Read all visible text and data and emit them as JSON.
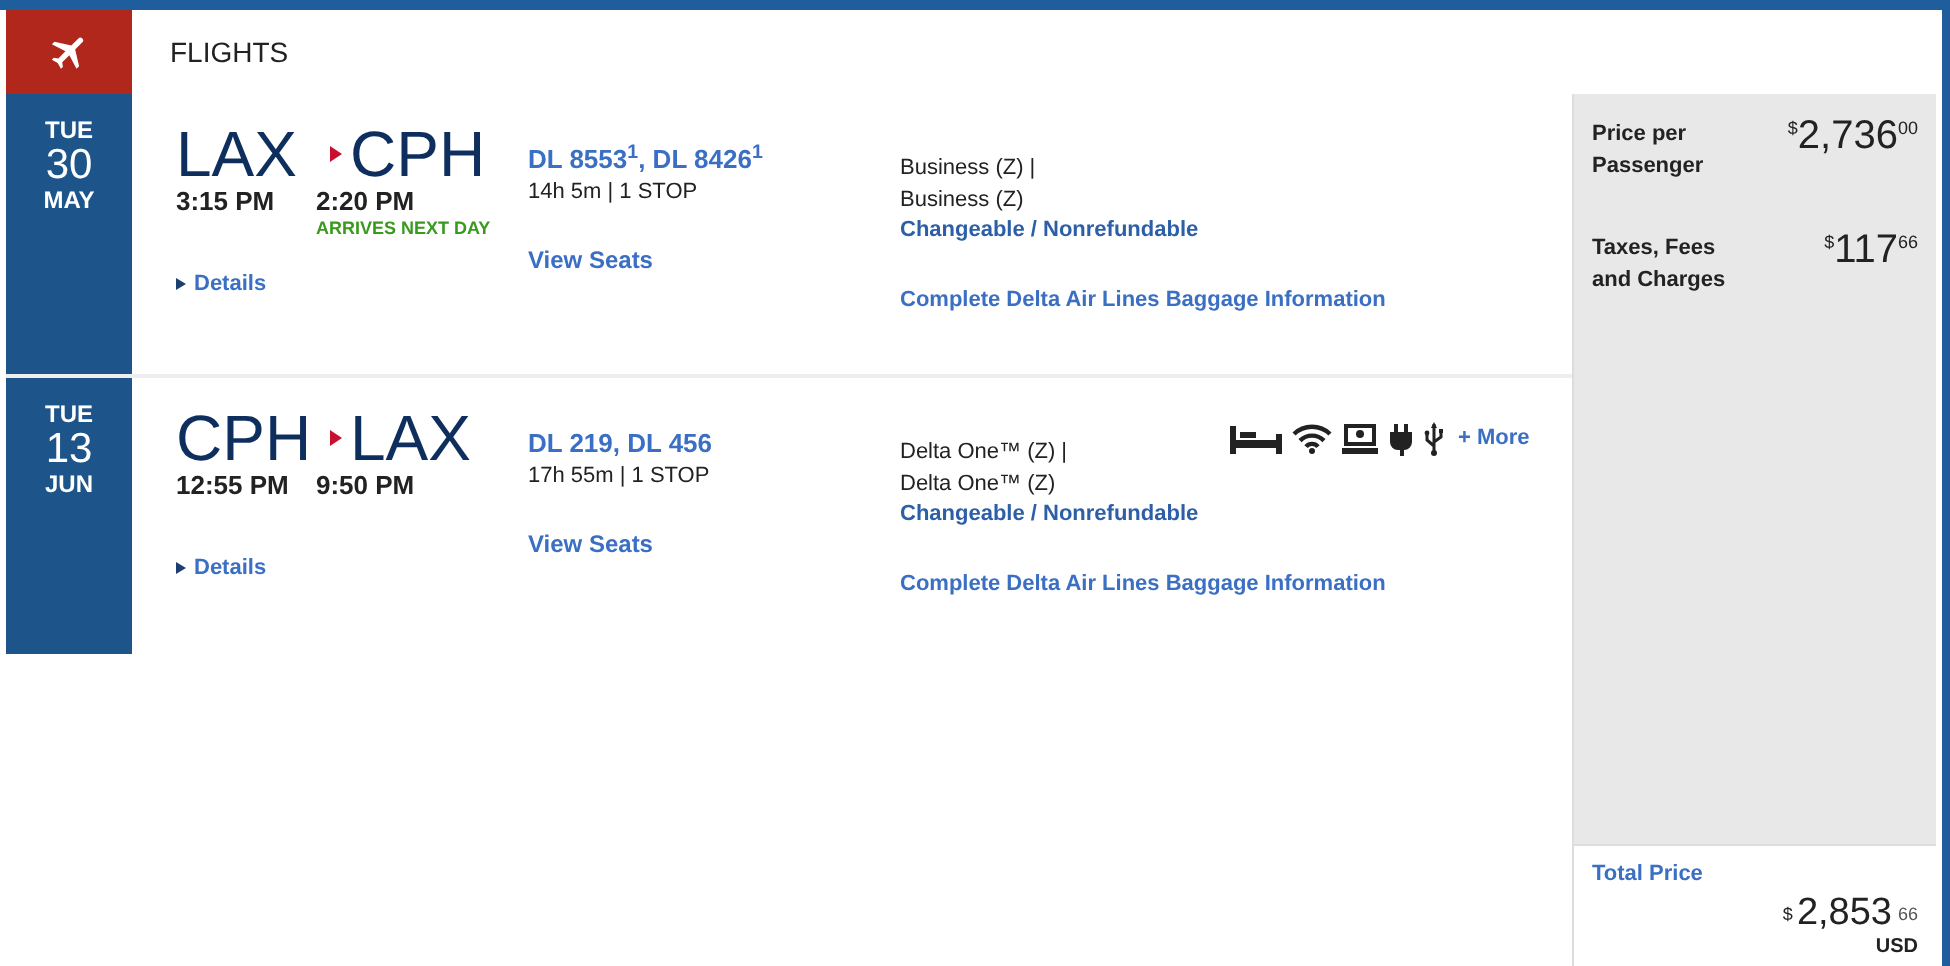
{
  "header": {
    "title": "FLIGHTS"
  },
  "legs": [
    {
      "date": {
        "weekday": "TUE",
        "day": "30",
        "month": "MAY"
      },
      "origin": "LAX",
      "destination": "CPH",
      "depart": "3:15 PM",
      "arrive": "2:20 PM",
      "arrival_note": "ARRIVES NEXT DAY",
      "flights": "DL 8553$^{1}$, DL 8426$^{1}$",
      "duration": "14h 5m | 1 STOP",
      "details": "Details",
      "view_seats": "View Seats",
      "cabin": [
        "Business (Z) |",
        "Business (Z)"
      ],
      "fare_rules": "Changeable / Nonrefundable",
      "baggage": "Complete Delta Air Lines Baggage Information"
    },
    {
      "date": {
        "weekday": "TUE",
        "day": "13",
        "month": "JUN"
      },
      "origin": "CPH",
      "destination": "LAX",
      "depart": "12:55 PM",
      "arrive": "9:50 PM",
      "flights": "DL 219, DL 456",
      "duration": "17h 55m | 1 STOP",
      "details": "Details",
      "view_seats": "View Seats",
      "cabin": [
        "Delta One™ (Z) |",
        "Delta One™ (Z)"
      ],
      "fare_rules": "Changeable / Nonrefundable",
      "baggage": "Complete Delta Air Lines Baggage Information",
      "amenities": [
        {
          "kind": "bed"
        },
        {
          "kind": "wifi"
        },
        {
          "kind": "screen"
        },
        {
          "kind": "power"
        },
        {
          "kind": "usb"
        }
      ],
      "more": "+ More"
    }
  ],
  "price": {
    "lines": [
      {
        "label": "Price per Passenger",
        "currency": "$",
        "amount": "2,736",
        "cents": "00"
      },
      {
        "label": "Taxes, Fees and Charges",
        "currency": "$",
        "amount": "117",
        "cents": "66"
      }
    ],
    "total": {
      "label": "Total Price",
      "currency": "$",
      "amount": "2,853",
      "cents": "66",
      "unit": "USD"
    }
  }
}
